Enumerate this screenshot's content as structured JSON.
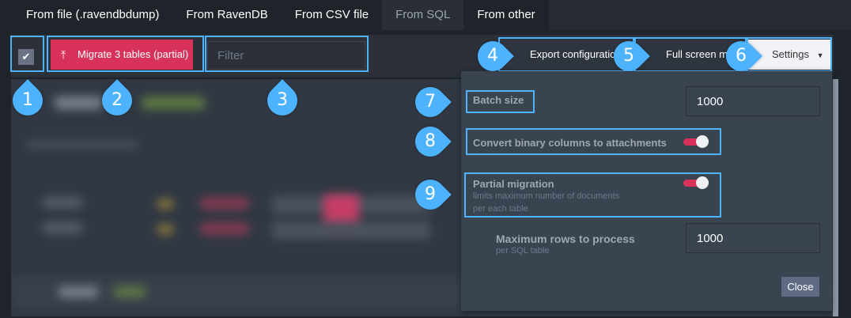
{
  "tabs": [
    {
      "label": "From file (.ravendbdump)"
    },
    {
      "label": "From RavenDB"
    },
    {
      "label": "From CSV file"
    },
    {
      "label": "From SQL",
      "active": true
    },
    {
      "label": "From other"
    }
  ],
  "toolbar": {
    "select_all_checked": true,
    "migrate_label": "Migrate 3 tables (partial)",
    "filter_placeholder": "Filter",
    "export_label": "Export configuration",
    "fullscreen_label": "Full screen mode",
    "settings_label": "Settings"
  },
  "settings": {
    "batch_size_label": "Batch size",
    "batch_size_value": "1000",
    "convert_binary_label": "Convert binary columns to attachments",
    "convert_binary_enabled": true,
    "partial_label": "Partial migration",
    "partial_desc_1": "limits maximum number of documents",
    "partial_desc_2": "per each table",
    "partial_enabled": true,
    "max_rows_label": "Maximum rows to process",
    "max_rows_sub": "per SQL table",
    "max_rows_value": "1000",
    "close_label": "Close"
  },
  "markers": [
    "1",
    "2",
    "3",
    "4",
    "5",
    "6",
    "7",
    "8",
    "9"
  ],
  "colors": {
    "accent": "#d8325a",
    "marker": "#4db3ff",
    "panel": "#3a4350"
  }
}
